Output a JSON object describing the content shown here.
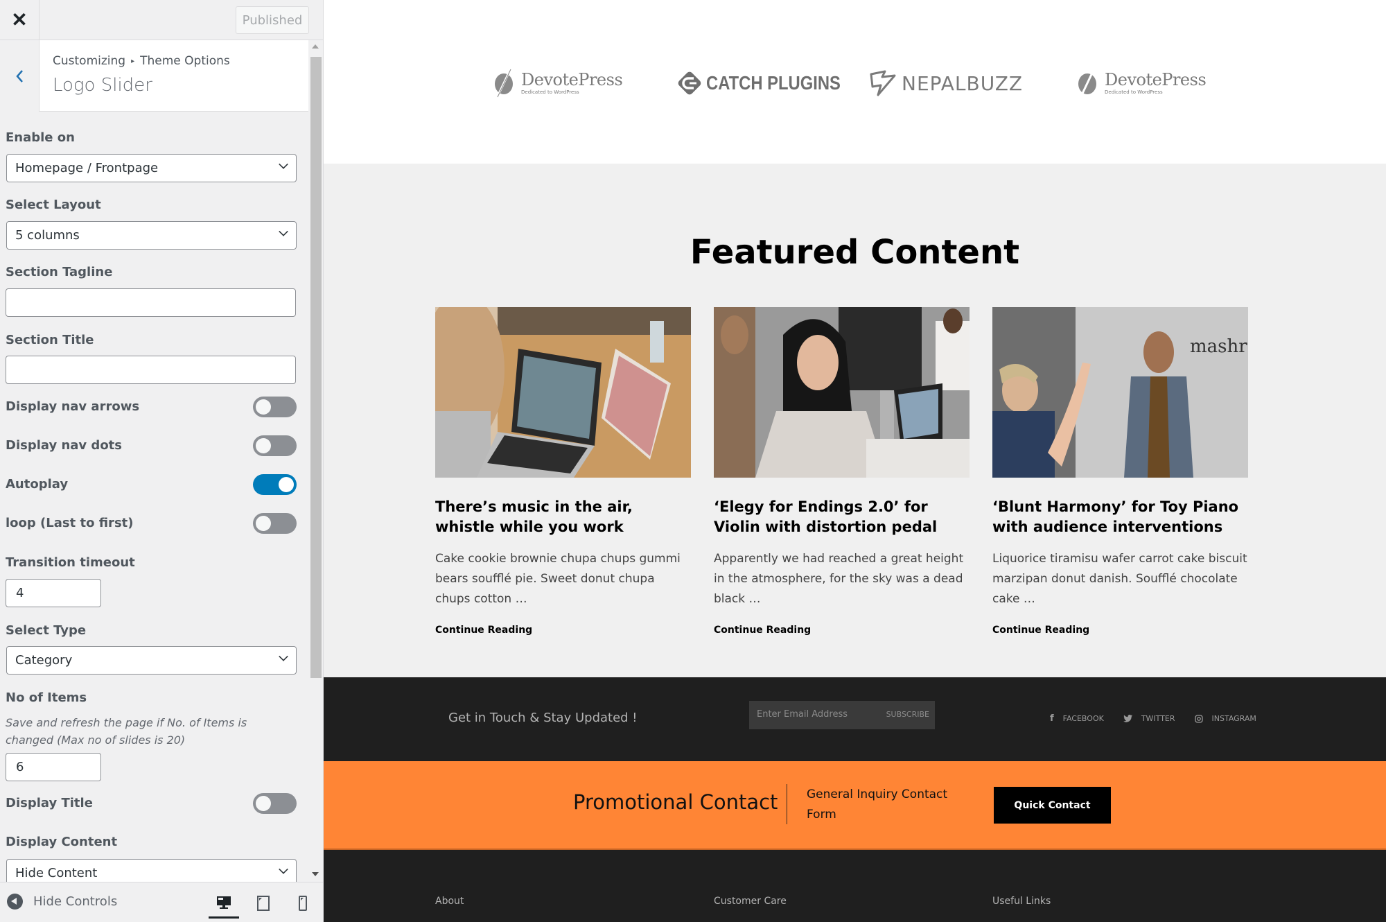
{
  "sidebar": {
    "close_icon": "close-icon",
    "publish_button": "Published",
    "breadcrumb": [
      "Customizing",
      "Theme Options"
    ],
    "title": "Logo Slider",
    "fields": {
      "enable_on": {
        "label": "Enable on",
        "value": "Homepage / Frontpage"
      },
      "select_layout": {
        "label": "Select Layout",
        "value": "5 columns"
      },
      "section_tagline": {
        "label": "Section Tagline",
        "value": ""
      },
      "section_title": {
        "label": "Section Title",
        "value": ""
      },
      "display_nav_arrows": {
        "label": "Display nav arrows",
        "on": false
      },
      "display_nav_dots": {
        "label": "Display nav dots",
        "on": false
      },
      "autoplay": {
        "label": "Autoplay",
        "on": true
      },
      "loop": {
        "label": "loop (Last to first)",
        "on": false
      },
      "transition_timeout": {
        "label": "Transition timeout",
        "value": "4"
      },
      "select_type": {
        "label": "Select Type",
        "value": "Category"
      },
      "no_of_items": {
        "label": "No of Items",
        "description": "Save and refresh the page if No. of Items is changed (Max no of slides is 20)",
        "value": "6"
      },
      "display_title": {
        "label": "Display Title",
        "on": false
      },
      "display_content": {
        "label": "Display Content",
        "value": "Hide Content"
      }
    },
    "footer": {
      "hide_controls": "Hide Controls",
      "devices": [
        "desktop",
        "tablet",
        "mobile"
      ],
      "active_device": "desktop"
    }
  },
  "preview": {
    "logos": [
      {
        "name": "DevotePress",
        "tagline": "Dedicated to WordPress"
      },
      {
        "name": "CATCH PLUGINS"
      },
      {
        "name": "NEPALBUZZ"
      },
      {
        "name": "DevotePress",
        "tagline": "Dedicated to WordPress"
      }
    ],
    "featured": {
      "title": "Featured Content",
      "cards": [
        {
          "title": "There’s music in the air, whistle while you work",
          "excerpt": "Cake cookie brownie chupa chups gummi bears soufflé pie. Sweet donut chupa chups cotton …",
          "link": "Continue Reading"
        },
        {
          "title": "‘Elegy for Endings 2.0’ for Violin with distortion pedal",
          "excerpt": "Apparently we had reached a great height in the atmosphere, for the sky was a dead black …",
          "link": "Continue Reading"
        },
        {
          "title": "‘Blunt Harmony’ for Toy Piano with audience interventions",
          "excerpt": "Liquorice tiramisu wafer carrot cake biscuit marzipan donut danish. Soufflé chocolate cake …",
          "link": "Continue Reading"
        }
      ]
    },
    "newsletter": {
      "text": "Get in Touch & Stay Updated !",
      "email_placeholder": "Enter Email Address",
      "subscribe": "SUBSCRIBE",
      "socials": [
        "FACEBOOK",
        "TWITTER",
        "INSTAGRAM"
      ]
    },
    "promo": {
      "title": "Promotional Contact",
      "subtitle": "General Inquiry Contact Form",
      "button": "Quick Contact"
    },
    "footer_columns": [
      "About",
      "Customer Care",
      "Useful Links"
    ]
  },
  "colors": {
    "accent_blue": "#007cba",
    "promo_orange": "#ff8535",
    "dark_band": "#1f1f1f"
  }
}
